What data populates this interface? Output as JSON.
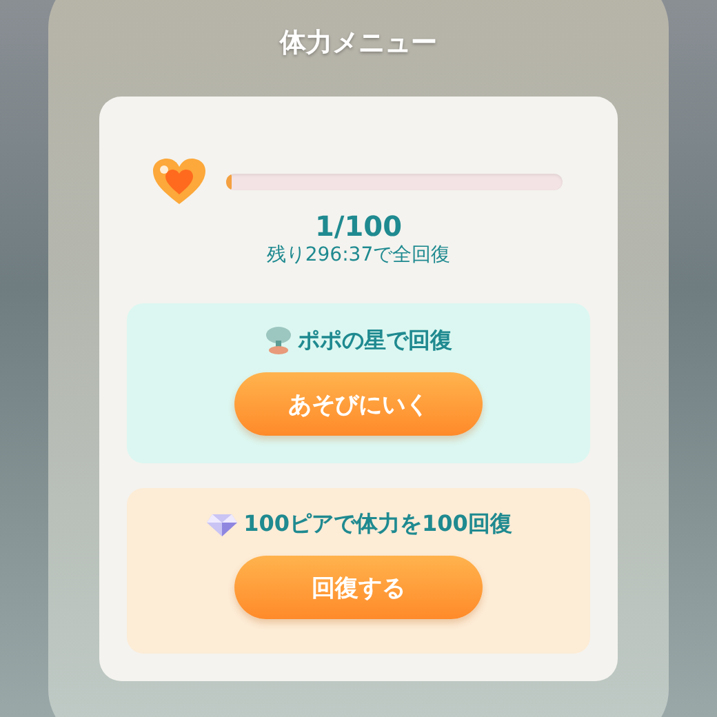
{
  "title": "体力メニュー",
  "stamina": {
    "level": 0.01,
    "value": "1/100",
    "recovery_time": "残り296:37で全回復"
  },
  "options": [
    {
      "kind": "play",
      "color": "#dcf7f1",
      "label": "ポポの星で回復",
      "button": "あそびにいく"
    },
    {
      "kind": "purchase",
      "color": "#fdecd6",
      "label": "100ピアで体力を100回復",
      "button": "回復する"
    }
  ]
}
